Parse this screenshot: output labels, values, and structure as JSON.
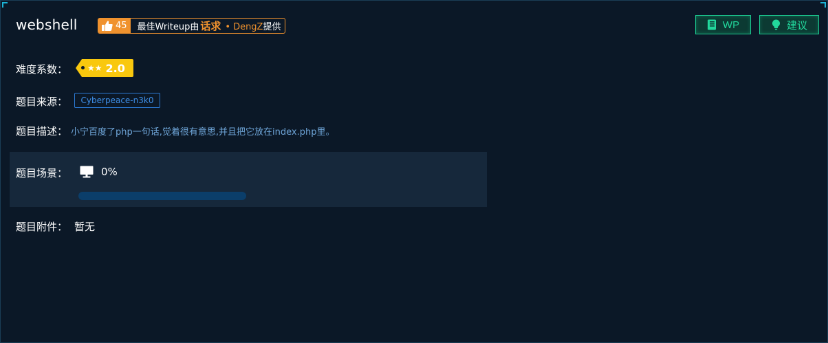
{
  "challenge": {
    "title": "webshell"
  },
  "writeup": {
    "likes": "45",
    "prefix": "最佳Writeup由",
    "author": "话求",
    "dot": "•",
    "author2": "DengZ",
    "suffix": "提供"
  },
  "actions": {
    "wp_label": "WP",
    "suggest_label": "建议"
  },
  "difficulty": {
    "label": "难度系数：",
    "stars": "★★",
    "score": "2.0"
  },
  "source": {
    "label": "题目来源：",
    "value": "Cyberpeace-n3k0"
  },
  "description": {
    "label": "题目描述：",
    "value": "小宁百度了php一句话,觉着很有意思,并且把它放在index.php里。"
  },
  "scene": {
    "label": "题目场景：",
    "percent_text": "0%",
    "progress": 0
  },
  "attachment": {
    "label": "题目附件：",
    "value": "暂无"
  },
  "colors": {
    "background": "#0b1827",
    "accent_orange": "#f0922e",
    "accent_green": "#22d89c",
    "accent_blue": "#2c7bd6",
    "difficulty_yellow": "#f9c80e"
  },
  "icons": {
    "likes": "thumbs-up-icon",
    "wp": "book-icon",
    "suggest": "lightbulb-icon",
    "scene": "monitor-icon"
  }
}
